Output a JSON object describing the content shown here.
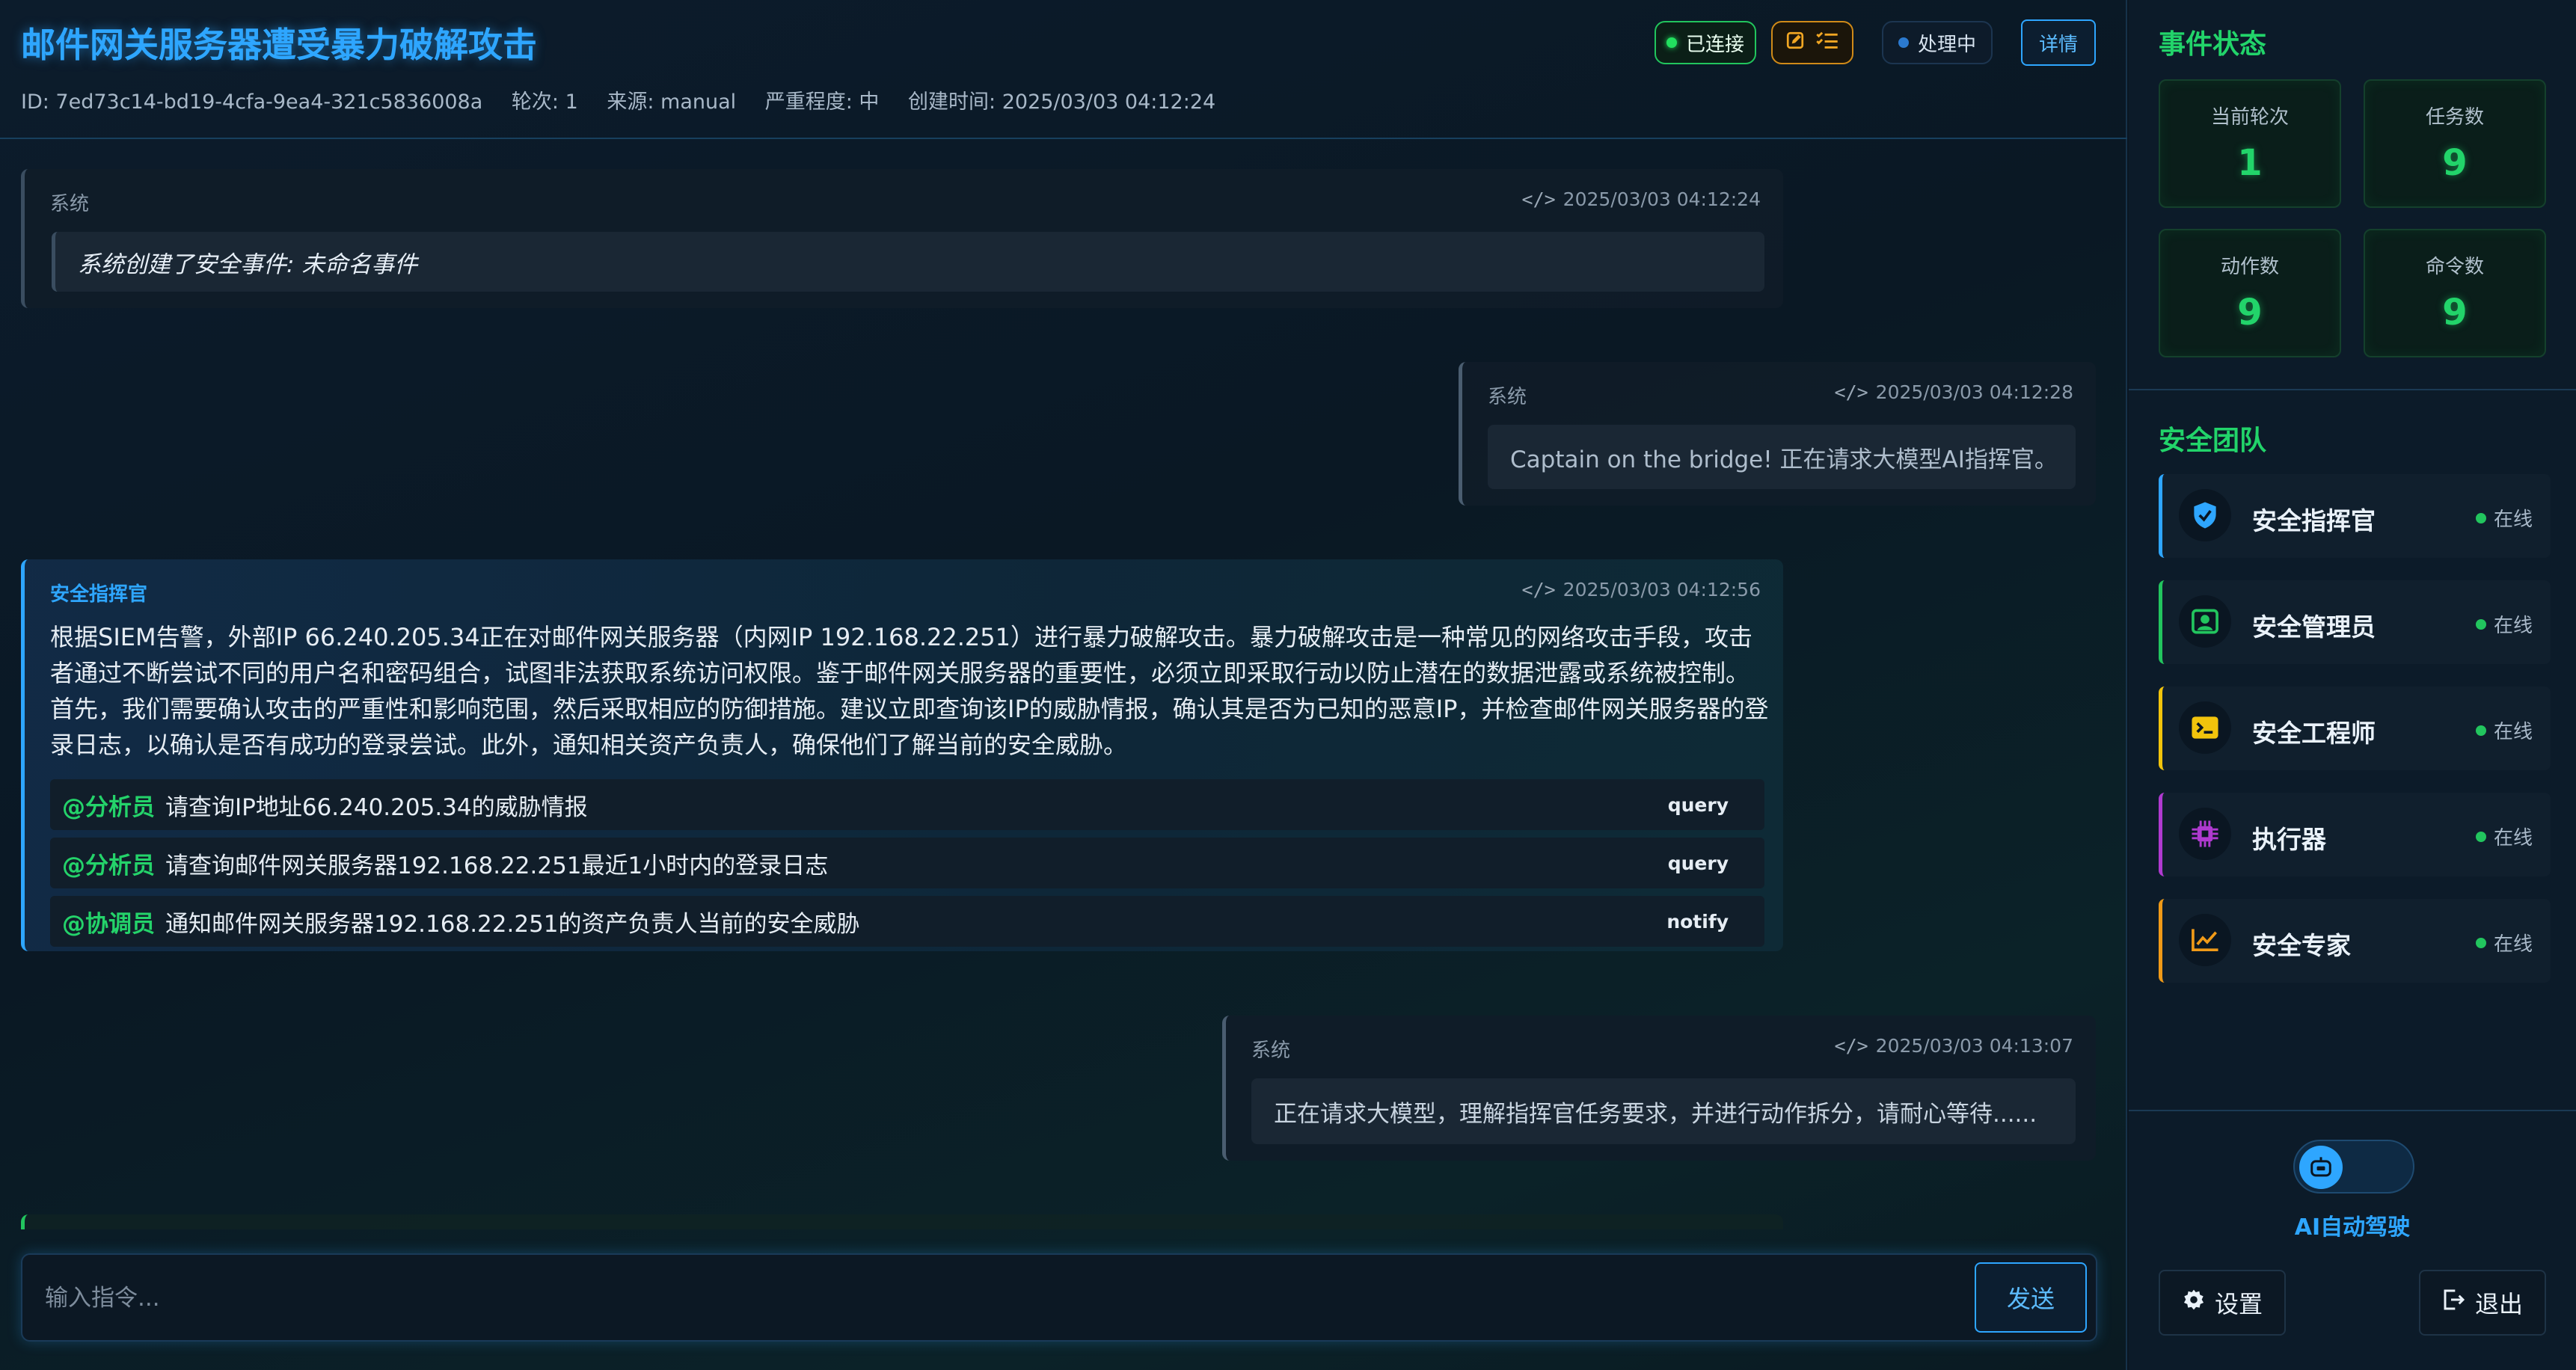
{
  "header": {
    "title": "邮件网关服务器遭受暴力破解攻击",
    "meta": {
      "id": "ID: 7ed73c14-bd19-4cfa-9ea4-321c5836008a",
      "round": "轮次: 1",
      "source": "来源: manual",
      "severity": "严重程度: 中",
      "created": "创建时间: 2025/03/03 04:12:24"
    },
    "badges": {
      "connected": "已连接",
      "processing": "处理中",
      "details": "详情"
    }
  },
  "messages": [
    {
      "sender": "系统",
      "time": "2025/03/03 04:12:24",
      "text": "系统创建了安全事件: 未命名事件"
    },
    {
      "sender": "系统",
      "time": "2025/03/03 04:12:28",
      "text": "Captain on the bridge! 正在请求大模型AI指挥官。"
    },
    {
      "sender": "安全指挥官",
      "time": "2025/03/03 04:12:56",
      "text": "根据SIEM告警，外部IP 66.240.205.34正在对邮件网关服务器（内网IP 192.168.22.251）进行暴力破解攻击。暴力破解攻击是一种常见的网络攻击手段，攻击者通过不断尝试不同的用户名和密码组合，试图非法获取系统访问权限。鉴于邮件网关服务器的重要性，必须立即采取行动以防止潜在的数据泄露或系统被控制。首先，我们需要确认攻击的严重性和影响范围，然后采取相应的防御措施。建议立即查询该IP的威胁情报，确认其是否为已知的恶意IP，并检查邮件网关服务器的登录日志，以确认是否有成功的登录尝试。此外，通知相关资产负责人，确保他们了解当前的安全威胁。",
      "tasks": [
        {
          "mention": "@分析员",
          "text": "请查询IP地址66.240.205.34的威胁情报",
          "type": "query"
        },
        {
          "mention": "@分析员",
          "text": "请查询邮件网关服务器192.168.22.251最近1小时内的登录日志",
          "type": "query"
        },
        {
          "mention": "@协调员",
          "text": "通知邮件网关服务器192.168.22.251的资产负责人当前的安全威胁",
          "type": "notify"
        }
      ]
    },
    {
      "sender": "系统",
      "time": "2025/03/03 04:13:07",
      "text": "正在请求大模型，理解指挥官任务要求，并进行动作拆分，请耐心等待......"
    }
  ],
  "input": {
    "placeholder": "输入指令...",
    "send_label": "发送"
  },
  "sidebar": {
    "status_title": "事件状态",
    "stats": [
      {
        "label": "当前轮次",
        "value": "1"
      },
      {
        "label": "任务数",
        "value": "9"
      },
      {
        "label": "动作数",
        "value": "9"
      },
      {
        "label": "命令数",
        "value": "9"
      }
    ],
    "team_title": "安全团队",
    "members": [
      {
        "name": "安全指挥官",
        "status": "在线",
        "icon": "shield-check-icon",
        "color": "#2ea6ff"
      },
      {
        "name": "安全管理员",
        "status": "在线",
        "icon": "user-badge-icon",
        "color": "#22c55e"
      },
      {
        "name": "安全工程师",
        "status": "在线",
        "icon": "terminal-icon",
        "color": "#f2c40c"
      },
      {
        "name": "执行器",
        "status": "在线",
        "icon": "cpu-chip-icon",
        "color": "#b03ad0"
      },
      {
        "name": "安全专家",
        "status": "在线",
        "icon": "chart-line-icon",
        "color": "#f09a18"
      }
    ],
    "ai_label": "AI自动驾驶",
    "settings_label": "设置",
    "logout_label": "退出"
  },
  "colors": {
    "accent": "#2ea6ff",
    "success": "#22d46a",
    "warning": "#f1a623",
    "background": "#0b1622"
  }
}
